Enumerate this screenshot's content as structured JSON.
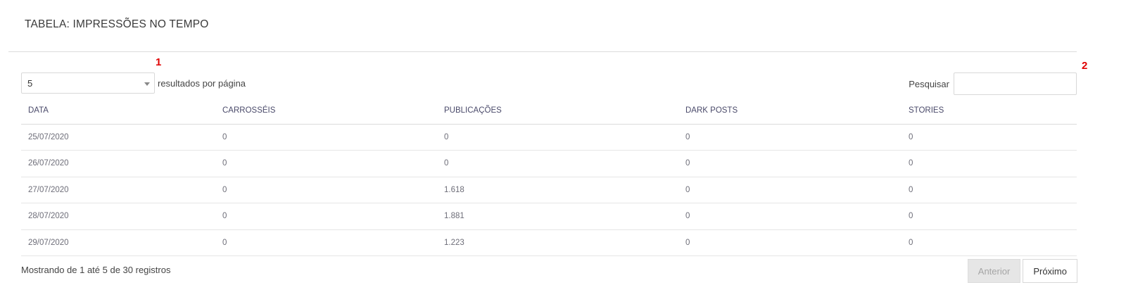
{
  "panel": {
    "title": "TABELA: IMPRESSÕES NO TEMPO"
  },
  "markers": {
    "one": "1",
    "two": "2"
  },
  "length": {
    "selected": "5",
    "label": "resultados por página"
  },
  "search": {
    "label": "Pesquisar",
    "value": "",
    "placeholder": ""
  },
  "table": {
    "headers": [
      "DATA",
      "CARROSSÉIS",
      "PUBLICAÇÕES",
      "DARK POSTS",
      "STORIES"
    ],
    "rows": [
      [
        "25/07/2020",
        "0",
        "0",
        "0",
        "0"
      ],
      [
        "26/07/2020",
        "0",
        "0",
        "0",
        "0"
      ],
      [
        "27/07/2020",
        "0",
        "1.618",
        "0",
        "0"
      ],
      [
        "28/07/2020",
        "0",
        "1.881",
        "0",
        "0"
      ],
      [
        "29/07/2020",
        "0",
        "1.223",
        "0",
        "0"
      ]
    ]
  },
  "info": "Mostrando de 1 até 5 de 30 registros",
  "pagination": {
    "previous": "Anterior",
    "next": "Próximo"
  }
}
